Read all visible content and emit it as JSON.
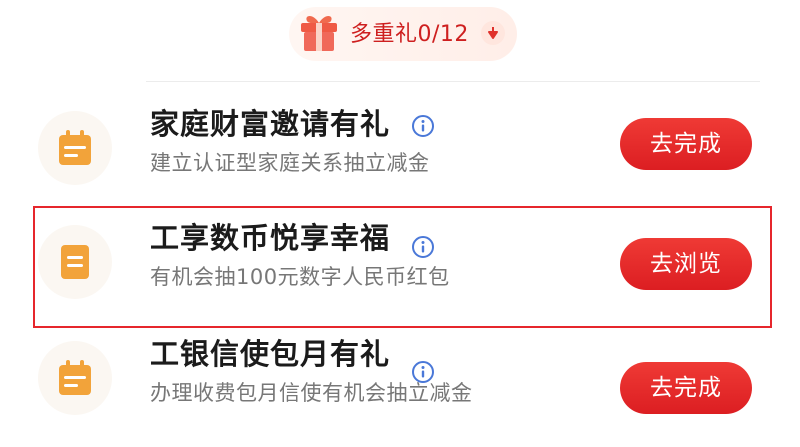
{
  "header": {
    "badge_label": "多重礼0/12"
  },
  "tasks": [
    {
      "title": "家庭财富邀请有礼",
      "description": "建立认证型家庭关系抽立减金",
      "action_label": "去完成",
      "icon": "calendar-icon"
    },
    {
      "title": "工享数币悦享幸福",
      "description": "有机会抽100元数字人民币红包",
      "action_label": "去浏览",
      "icon": "document-icon",
      "highlighted": true
    },
    {
      "title": "工银信使包月有礼",
      "description": "办理收费包月信使有机会抽立减金",
      "action_label": "去完成",
      "icon": "calendar-icon"
    }
  ],
  "colors": {
    "accent": "#dc1e22",
    "icon": "#f2a33a",
    "highlight_border": "#e6262c"
  }
}
